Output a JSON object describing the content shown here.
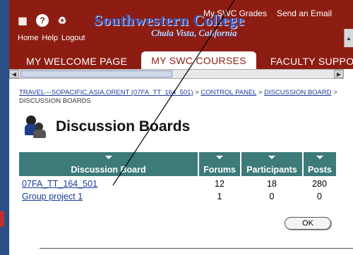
{
  "header": {
    "brand_title": "Southwestern College",
    "brand_subtitle": "Chula Vista, California",
    "top_links": [
      "My SWC Grades",
      "Send an Email"
    ],
    "nav_labels": [
      "Home",
      "Help",
      "Logout"
    ]
  },
  "tabs": [
    {
      "label": "MY WELCOME PAGE",
      "active": false
    },
    {
      "label": "MY SWC COURSES",
      "active": true
    },
    {
      "label": "FACULTY SUPPO",
      "active": false
    }
  ],
  "breadcrumb": {
    "course_link": "TRAVEL---SOPACIFIC,ASIA,ORENT (07FA_TT_164_501)",
    "sep1": " > ",
    "control_panel": "CONTROL PANEL",
    "sep2": " > ",
    "discussion_board": "DISCUSSION BOARD",
    "sep3": " > ",
    "current": "DISCUSSION BOARDS"
  },
  "page": {
    "title": "Discussion Boards"
  },
  "table": {
    "headers": [
      "Discussion Board",
      "Forums",
      "Participants",
      "Posts"
    ],
    "rows": [
      {
        "name": "07FA_TT_164_501",
        "forums": "12",
        "participants": "18",
        "posts": "280"
      },
      {
        "name": "Group project 1",
        "forums": "1",
        "participants": "0",
        "posts": "0"
      }
    ]
  },
  "ok_label": "OK",
  "colors": {
    "header_bg": "#8d1d13",
    "table_header_bg": "#3d7a7a",
    "link": "#1a3a9a",
    "left_strip": "#2a4f86"
  }
}
